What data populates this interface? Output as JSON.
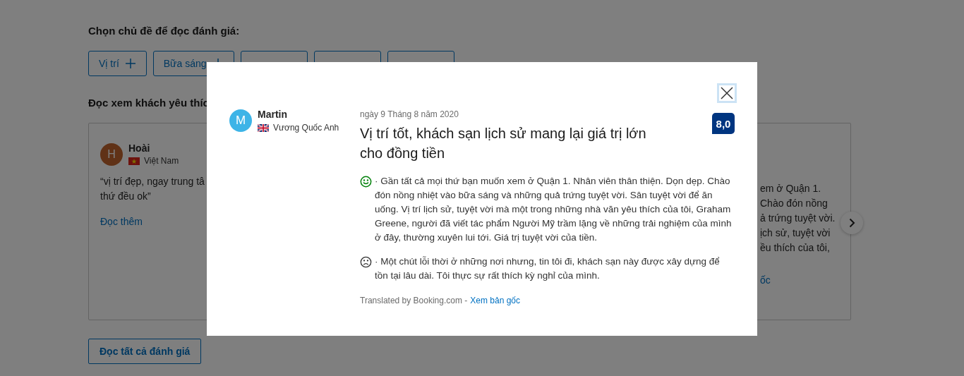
{
  "topics_heading": "Chọn chủ đề để đọc đánh giá:",
  "topics": [
    {
      "kind": "label",
      "label": "Vị trí"
    },
    {
      "kind": "label",
      "label": "Bữa sáng"
    },
    {
      "kind": "covered"
    },
    {
      "kind": "covered"
    },
    {
      "kind": "covered"
    }
  ],
  "reviews_heading": "Đọc xem khách yêu thíc",
  "cards": [
    {
      "kind": "guest",
      "initial": "H",
      "name": "Hoài",
      "country": "Việt Nam",
      "lines": [
        "“vị trí đẹp, ngay trung tâ",
        "thứ đều ok”"
      ],
      "link": "Đọc thêm"
    },
    {
      "kind": "tail",
      "lines": [
        "em ở Quận 1.",
        "Chào đón nồng",
        "ả trứng tuyệt vời.",
        "ịch sử, tuyệt vời",
        "ều thích của tôi,"
      ],
      "link": "ốc"
    }
  ],
  "read_all_button": "Đọc tất cả đánh giá",
  "modal": {
    "reviewer": {
      "initial": "M",
      "name": "Martin",
      "country": "Vương Quốc Anh"
    },
    "date": "ngày 9 Tháng 8 năm 2020",
    "title": "Vị trí tốt, khách sạn lịch sử mang lại giá trị lớn cho đồng tiền",
    "score": "8,0",
    "paragraphs": [
      {
        "kind": "positive",
        "text": "· Gần tất cả mọi thứ bạn muốn xem ở Quận 1. Nhân viên thân thiện. Dọn dẹp. Chào đón nồng nhiệt vào bữa sáng và những quả trứng tuyệt vời. Sân tuyệt vời để ăn uống. Vị trí lịch sử, tuyệt vời mà một trong những nhà văn yêu thích của tôi, Graham Greene, người đã viết tác phẩm Người Mỹ trầm lặng về những trải nghiệm của mình ở đây, thường xuyên lui tới. Giá trị tuyệt vời của tiền."
      },
      {
        "kind": "negative",
        "text": "· Một chút lỗi thời ở những nơi nhưng, tin tôi đi, khách sạn này được xây dựng để tồn tại lâu dài. Tôi thực sự rất thích kỳ nghỉ của mình."
      }
    ],
    "translated_note": "Translated by Booking.com -",
    "original_link": "Xem bản gốc"
  }
}
